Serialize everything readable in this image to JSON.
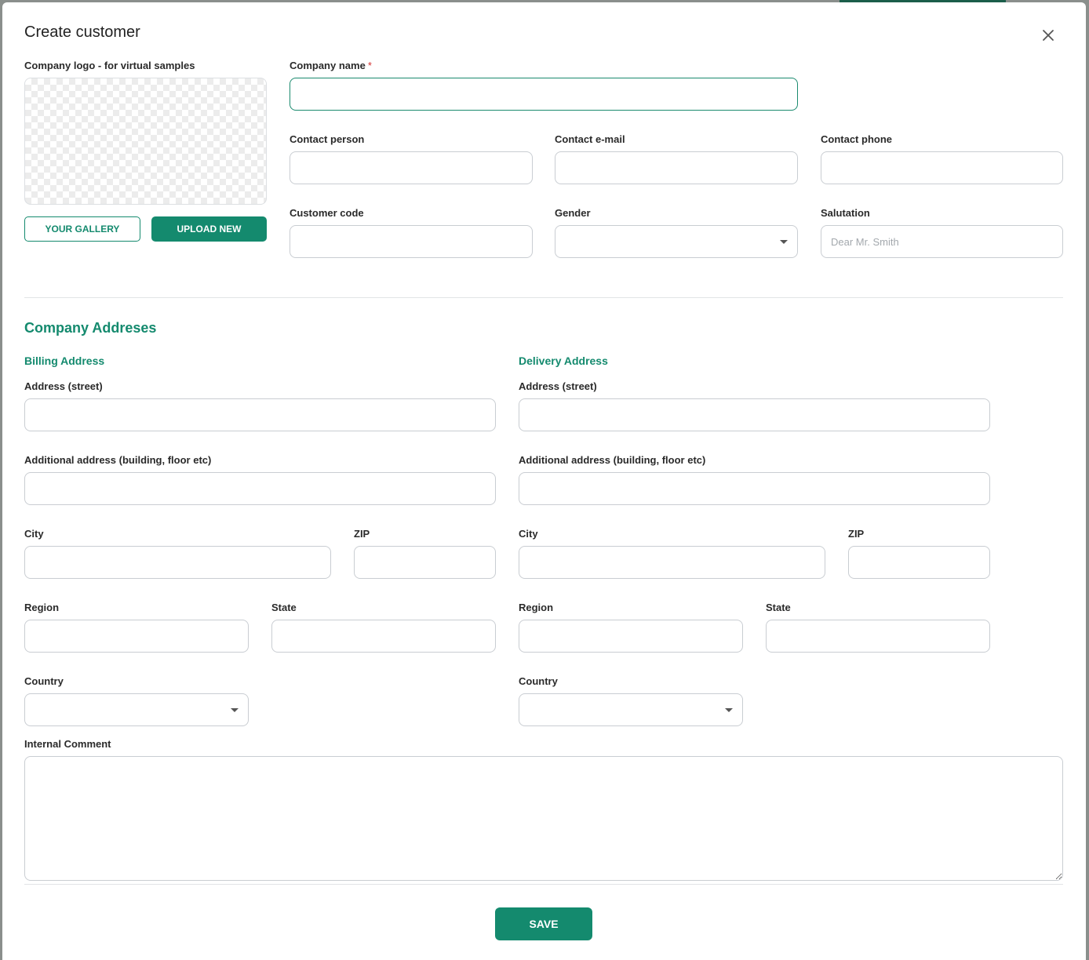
{
  "dialog": {
    "title": "Create customer",
    "close_icon": "close-icon"
  },
  "logo": {
    "label": "Company logo - for virtual samples",
    "gallery_button": "YOUR GALLERY",
    "upload_button": "UPLOAD NEW"
  },
  "company": {
    "name_label": "Company name",
    "required_marker": "*",
    "contact_person_label": "Contact person",
    "contact_email_label": "Contact e-mail",
    "contact_phone_label": "Contact phone",
    "customer_code_label": "Customer code",
    "gender_label": "Gender",
    "salutation_label": "Salutation",
    "salutation_placeholder": "Dear Mr. Smith"
  },
  "addresses": {
    "section_title": "Company Addreses",
    "billing": {
      "title": "Billing Address",
      "street_label": "Address (street)",
      "additional_label": "Additional address (building, floor etc)",
      "city_label": "City",
      "zip_label": "ZIP",
      "region_label": "Region",
      "state_label": "State",
      "country_label": "Country"
    },
    "delivery": {
      "title": "Delivery Address",
      "street_label": "Address (street)",
      "additional_label": "Additional address (building, floor etc)",
      "city_label": "City",
      "zip_label": "ZIP",
      "region_label": "Region",
      "state_label": "State",
      "country_label": "Country"
    }
  },
  "comment": {
    "label": "Internal Comment"
  },
  "footer": {
    "save_label": "SAVE"
  },
  "colors": {
    "accent": "#148a6e",
    "required": "#d32f2f"
  }
}
